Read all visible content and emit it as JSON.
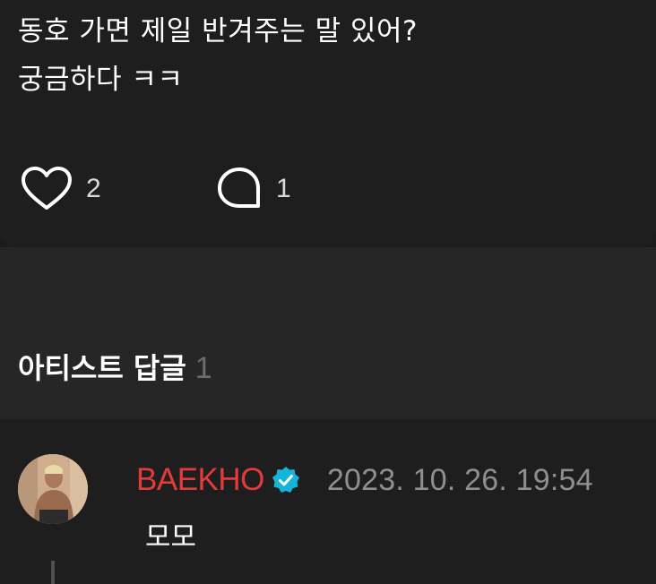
{
  "post": {
    "text": "동호 가면 제일 반겨주는 말 있어?\n궁금하다 ㅋㅋ",
    "like_count": "2",
    "comment_count": "1"
  },
  "section": {
    "title": "아티스트 답글",
    "count": "1"
  },
  "reply": {
    "author": "BAEKHO",
    "date": "2023. 10. 26. 19:54",
    "text": "모모",
    "verified_icon": "verified-badge-icon"
  },
  "colors": {
    "background": "#1e1e1e",
    "divider_band": "#262626",
    "author_name": "#e23b3b",
    "verified_badge": "#17b3d9",
    "secondary_text": "#8f8f8f"
  }
}
